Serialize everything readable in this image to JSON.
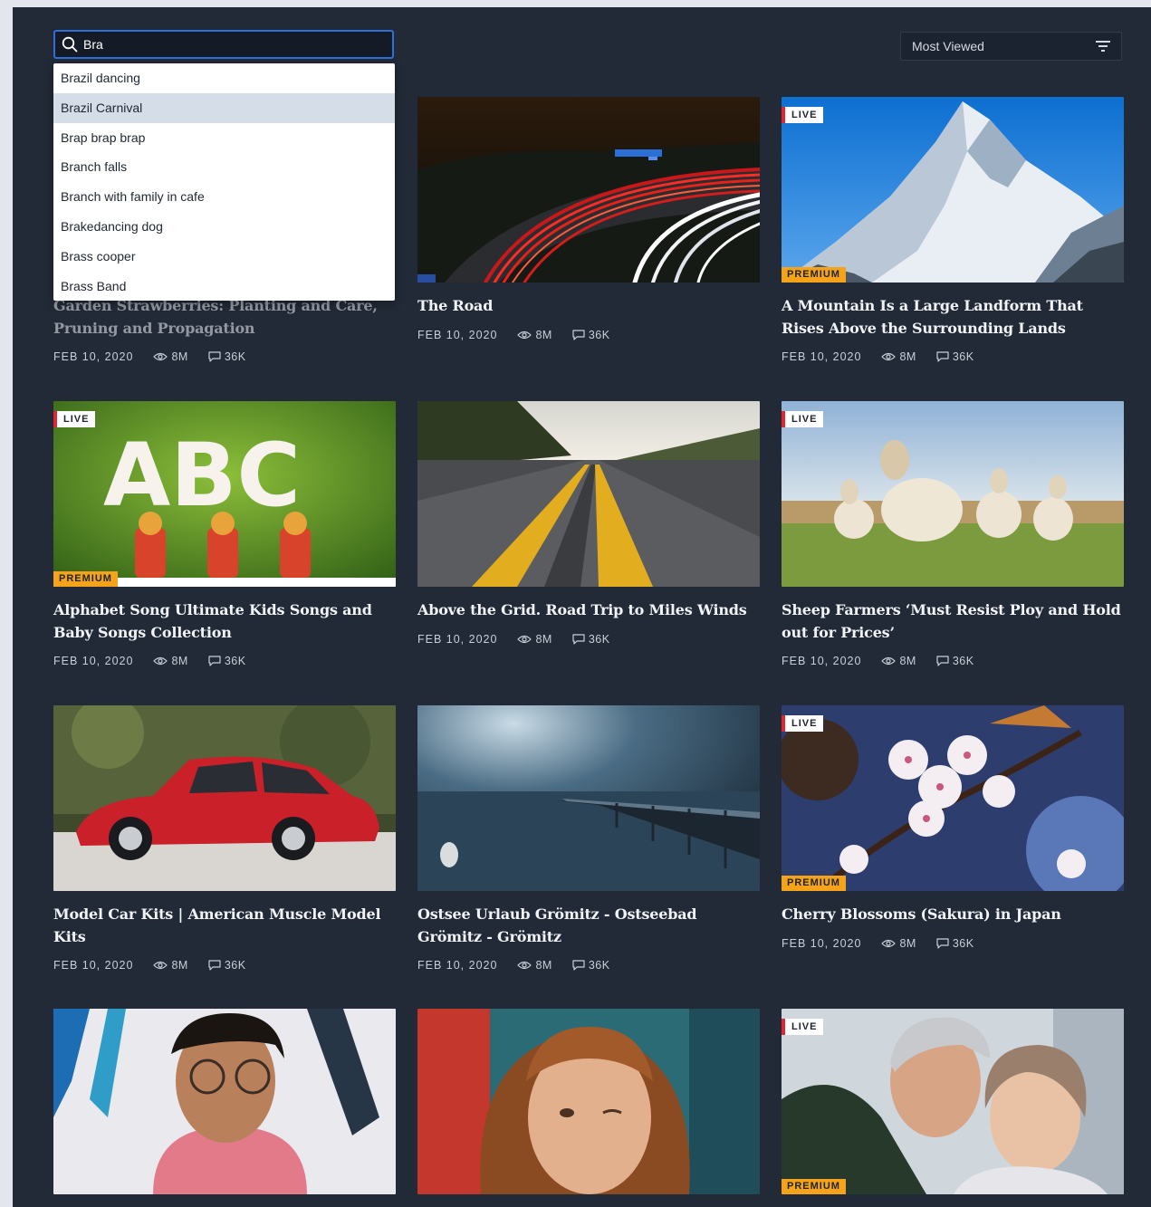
{
  "search": {
    "value": "Bra",
    "suggestions": [
      "Brazil dancing",
      "Brazil Carnival",
      "Brap brap brap",
      "Branch falls",
      "Branch with family in cafe",
      "Brakedancing dog",
      "Brass cooper",
      "Brass Band"
    ],
    "selected_index": 1
  },
  "sort": {
    "label": "Most Viewed"
  },
  "badges": {
    "live": "LIVE",
    "premium": "PREMIUM"
  },
  "cards": [
    {
      "title": "Garden Strawberries: Planting and Care, Pruning and Propagation",
      "date": "FEB 10, 2020",
      "views": "8M",
      "comments": "36K"
    },
    {
      "title": "The Road",
      "date": "FEB 10, 2020",
      "views": "8M",
      "comments": "36K"
    },
    {
      "title": "A Mountain Is a Large Landform That Rises Above the Surrounding Lands",
      "date": "FEB 10, 2020",
      "views": "8M",
      "comments": "36K",
      "live": true,
      "premium": true
    },
    {
      "title": "Alphabet Song Ultimate Kids Songs and Baby Songs Collection",
      "date": "FEB 10, 2020",
      "views": "8M",
      "comments": "36K",
      "live": true,
      "premium": true
    },
    {
      "title": "Above the Grid. Road Trip to Miles Winds",
      "date": "FEB 10, 2020",
      "views": "8M",
      "comments": "36K"
    },
    {
      "title": "Sheep Farmers ‘Must Resist Ploy and Hold out for Prices’",
      "date": "FEB 10, 2020",
      "views": "8M",
      "comments": "36K",
      "live": true
    },
    {
      "title": "Model Car Kits | American Muscle Model Kits",
      "date": "FEB 10, 2020",
      "views": "8M",
      "comments": "36K"
    },
    {
      "title": "Ostsee Urlaub Grömitz - Ostseebad Grömitz - Grömitz",
      "date": "FEB 10, 2020",
      "views": "8M",
      "comments": "36K"
    },
    {
      "title": "Cherry Blossoms (Sakura) in Japan",
      "date": "FEB 10, 2020",
      "views": "8M",
      "comments": "36K",
      "live": true,
      "premium": true
    },
    {
      "title": "",
      "live": false
    },
    {
      "title": ""
    },
    {
      "title": "",
      "live": true,
      "premium": true
    }
  ],
  "colors": {
    "page_bg": "#222a37",
    "accent": "#2f6fd8",
    "live": "#e4252f",
    "premium": "#f5a31a"
  },
  "icons": [
    "search-icon",
    "filter-icon",
    "eye-icon",
    "comment-icon"
  ]
}
